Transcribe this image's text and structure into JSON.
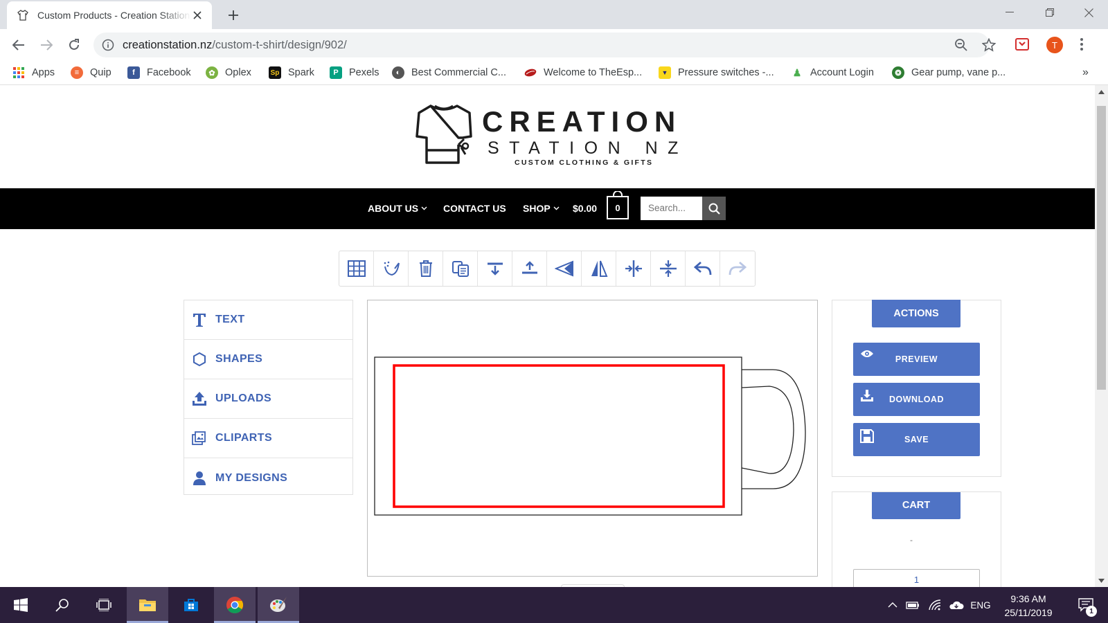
{
  "browser": {
    "tab_title": "Custom Products - Creation Station NZ",
    "url_host": "creationstation.nz",
    "url_path": "/custom-t-shirt/design/902/",
    "profile_initial": "T",
    "bookmarks": [
      {
        "label": "Apps",
        "icon": "apps-grid-icon",
        "color": "#ea4335"
      },
      {
        "label": "Quip",
        "icon": "quip-icon",
        "color": "#f26b3a"
      },
      {
        "label": "Facebook",
        "icon": "facebook-icon",
        "color": "#3b5998"
      },
      {
        "label": "Oplex",
        "icon": "oplex-icon",
        "color": "#7cb342"
      },
      {
        "label": "Spark",
        "icon": "spark-icon",
        "color": "#f5c518"
      },
      {
        "label": "Pexels",
        "icon": "pexels-icon",
        "color": "#05a081"
      },
      {
        "label": "Best Commercial C...",
        "icon": "globe-icon",
        "color": "#555555"
      },
      {
        "label": "Welcome to TheEsp...",
        "icon": "coffee-bean-icon",
        "color": "#b71c1c"
      },
      {
        "label": "Pressure switches -...",
        "icon": "pressure-switch-icon",
        "color": "#f9d71c"
      },
      {
        "label": "Account Login",
        "icon": "account-icon",
        "color": "#4caf50"
      },
      {
        "label": "Gear pump, vane p...",
        "icon": "gear-pump-icon",
        "color": "#2e7d32"
      }
    ]
  },
  "site": {
    "logo_title": "CREATION",
    "logo_sub": "STATION NZ",
    "logo_tagline": "CUSTOM CLOTHING & GIFTS",
    "nav": {
      "about": "ABOUT US",
      "contact": "CONTACT US",
      "shop": "SHOP",
      "cart_total": "$0.00",
      "cart_count": "0",
      "search_placeholder": "Search..."
    }
  },
  "designer": {
    "toolbar_tools": [
      "grid-icon",
      "clear-canvas-icon",
      "delete-icon",
      "duplicate-icon",
      "align-bottom-icon",
      "align-top-icon",
      "flip-horizontal-icon",
      "flip-vertical-icon",
      "center-horizontal-icon",
      "center-vertical-icon",
      "undo-icon",
      "redo-icon"
    ],
    "left_menu": [
      "TEXT",
      "SHAPES",
      "UPLOADS",
      "CLIPARTS",
      "MY DESIGNS"
    ],
    "actions_title": "ACTIONS",
    "actions": [
      "PREVIEW",
      "DOWNLOAD",
      "SAVE"
    ],
    "cart_title": "CART",
    "cart_dash": "-",
    "quantity": "1",
    "accent_color": "#4f73c5",
    "print_area_color": "#ff0000"
  },
  "taskbar": {
    "time": "9:36 AM",
    "date": "25/11/2019",
    "language": "ENG",
    "notifications": "1"
  }
}
